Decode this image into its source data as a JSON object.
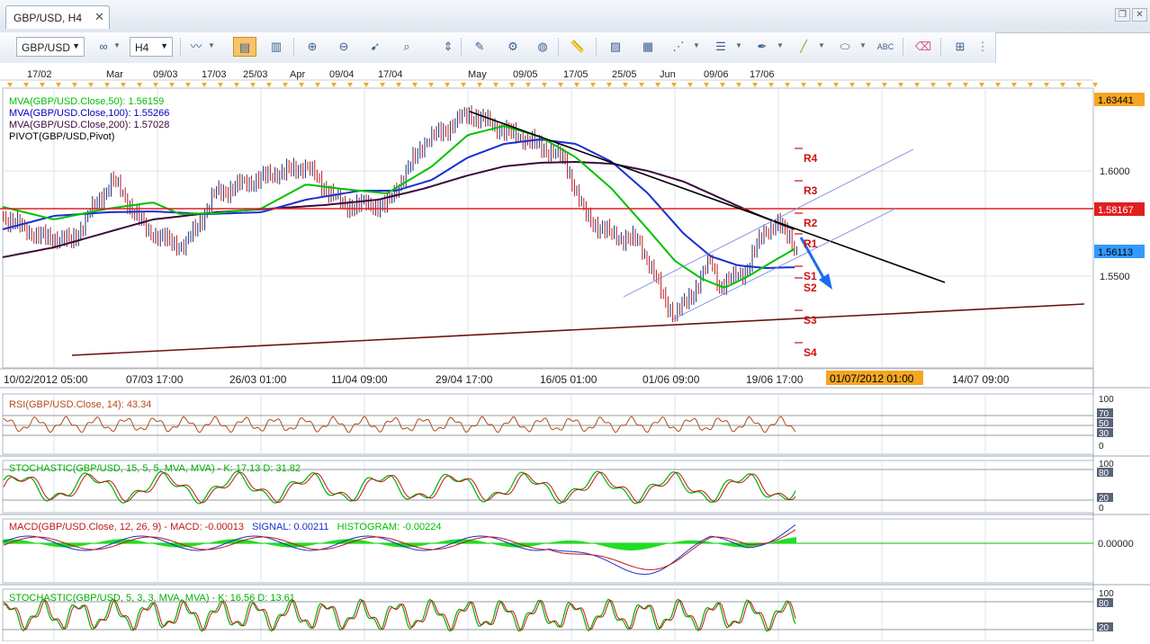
{
  "window": {
    "tab_title": "GBP/USD, H4",
    "close_glyph": "✕",
    "restore_glyph": "❐",
    "close_window_glyph": "✕"
  },
  "toolbar": {
    "symbol": "GBP/USD",
    "timeframe": "H4",
    "icons": [
      "link-icon",
      "bar-chart-icon",
      "candle-chart-icon",
      "line-chart-icon",
      "zoom-in-icon",
      "zoom-out-icon",
      "cursor-icon",
      "crosshair-icon",
      "fit-icon",
      "draw-icon",
      "settings-icon",
      "globe-icon",
      "ruler-icon",
      "picture-icon",
      "layout-icon",
      "lines-icon",
      "menu-icon",
      "pen-icon",
      "brush-icon",
      "ellipse-icon",
      "text-icon",
      "eraser-icon",
      "tree-icon",
      "more-icon"
    ]
  },
  "top_dates": [
    "17/02",
    "Mar",
    "09/03",
    "17/03",
    "25/03",
    "Apr",
    "09/04",
    "17/04",
    "May",
    "09/05",
    "17/05",
    "25/05",
    "Jun",
    "09/06",
    "17/06"
  ],
  "bottom_dates": [
    "10/02/2012 05:00",
    "07/03 17:00",
    "26/03 01:00",
    "11/04 09:00",
    "29/04 17:00",
    "16/05 01:00",
    "01/06 09:00",
    "19/06 17:00",
    "14/07 09:00"
  ],
  "cursor_date": "01/07/2012 01:00",
  "main": {
    "legend": [
      {
        "text": "MVA(GBP/USD.Close,50): 1.56159",
        "color": "#00c000"
      },
      {
        "text": "MVA(GBP/USD.Close,100): 1.55266",
        "color": "#0000c0"
      },
      {
        "text": "MVA(GBP/USD.Close,200): 1.57028",
        "color": "#3a0a3a"
      },
      {
        "text": "PIVOT(GBP/USD,Pivot)",
        "color": "#000000"
      }
    ],
    "y_labels": [
      "1.6000",
      "1.5500"
    ],
    "price_tags": [
      {
        "value": "1.63441",
        "bg": "#f5a623"
      },
      {
        "value": "1.58167",
        "bg": "#e02020"
      },
      {
        "value": "1.56113",
        "bg": "#3399ff"
      }
    ],
    "pivots": [
      "R4",
      "R3",
      "R2",
      "R1",
      "S1",
      "S2",
      "S3",
      "S4"
    ]
  },
  "rsi": {
    "label": "RSI(GBP/USD.Close, 14): 43.34",
    "levels": [
      "100",
      "70",
      "50",
      "30",
      "0"
    ]
  },
  "stoch1": {
    "label": "STOCHASTIC(GBP/USD, 15, 5, 5, MVA, MVA) -  K: 17.13   D: 31.82",
    "levels": [
      "100",
      "80",
      "20",
      "0"
    ]
  },
  "macd": {
    "name": "MACD(GBP/USD.Close, 12, 26, 9) -  MACD: -0.00013",
    "signal": "SIGNAL: 0.00211",
    "histo": "HISTOGRAM: -0.00224",
    "level": "0.00000"
  },
  "stoch2": {
    "label": "STOCHASTIC(GBP/USD, 5, 3, 3, MVA, MVA) -  K: 16.56   D: 13.61",
    "levels": [
      "100",
      "80",
      "20"
    ]
  },
  "colors": {
    "ma50": "#00c000",
    "ma100": "#1a2fd0",
    "ma200": "#3a0a3a",
    "bull": "#1d2f7a",
    "bear": "#c01818"
  }
}
